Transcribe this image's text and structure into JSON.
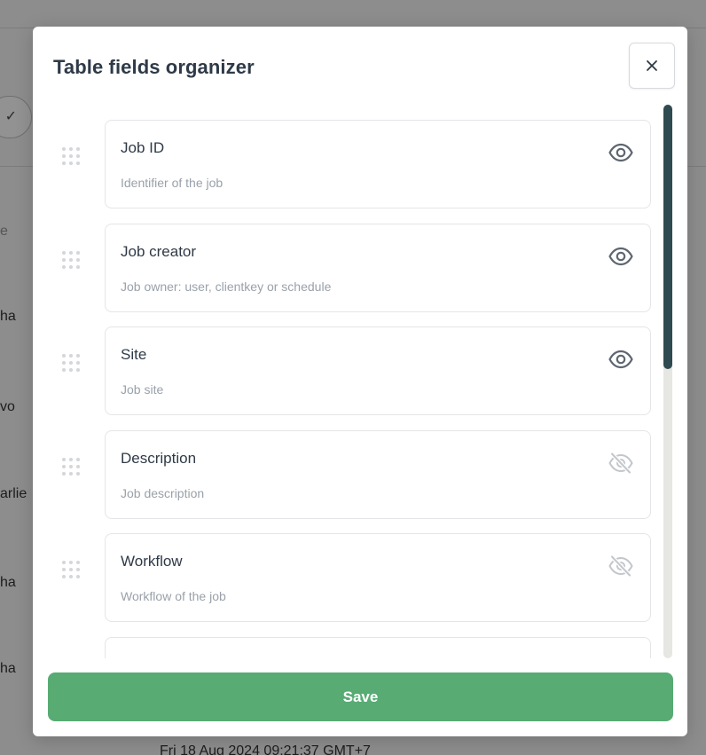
{
  "background": {
    "peek_texts": [
      "e",
      "ha",
      "vo",
      "arlie",
      "ha",
      "ha"
    ],
    "check_glyph": "✓",
    "bottom_text": "Fri 18 Aug 2024 09:21:37 GMT+7"
  },
  "modal": {
    "title": "Table fields organizer",
    "close_icon": "close-icon",
    "fields": [
      {
        "name": "Job ID",
        "description": "Identifier of the job",
        "visible": true
      },
      {
        "name": "Job creator",
        "description": "Job owner: user, clientkey or schedule",
        "visible": true
      },
      {
        "name": "Site",
        "description": "Job site",
        "visible": true
      },
      {
        "name": "Description",
        "description": "Job description",
        "visible": false
      },
      {
        "name": "Workflow",
        "description": "Workflow of the job",
        "visible": false
      },
      {
        "name": "",
        "description": "",
        "visible": false
      }
    ],
    "save_label": "Save",
    "colors": {
      "save_button": "#57ab73",
      "scroll_thumb": "#2f4a51",
      "icon_visible": "#5e6670",
      "icon_hidden": "#c3c7cc",
      "overlay": "#8d8d8d"
    }
  }
}
